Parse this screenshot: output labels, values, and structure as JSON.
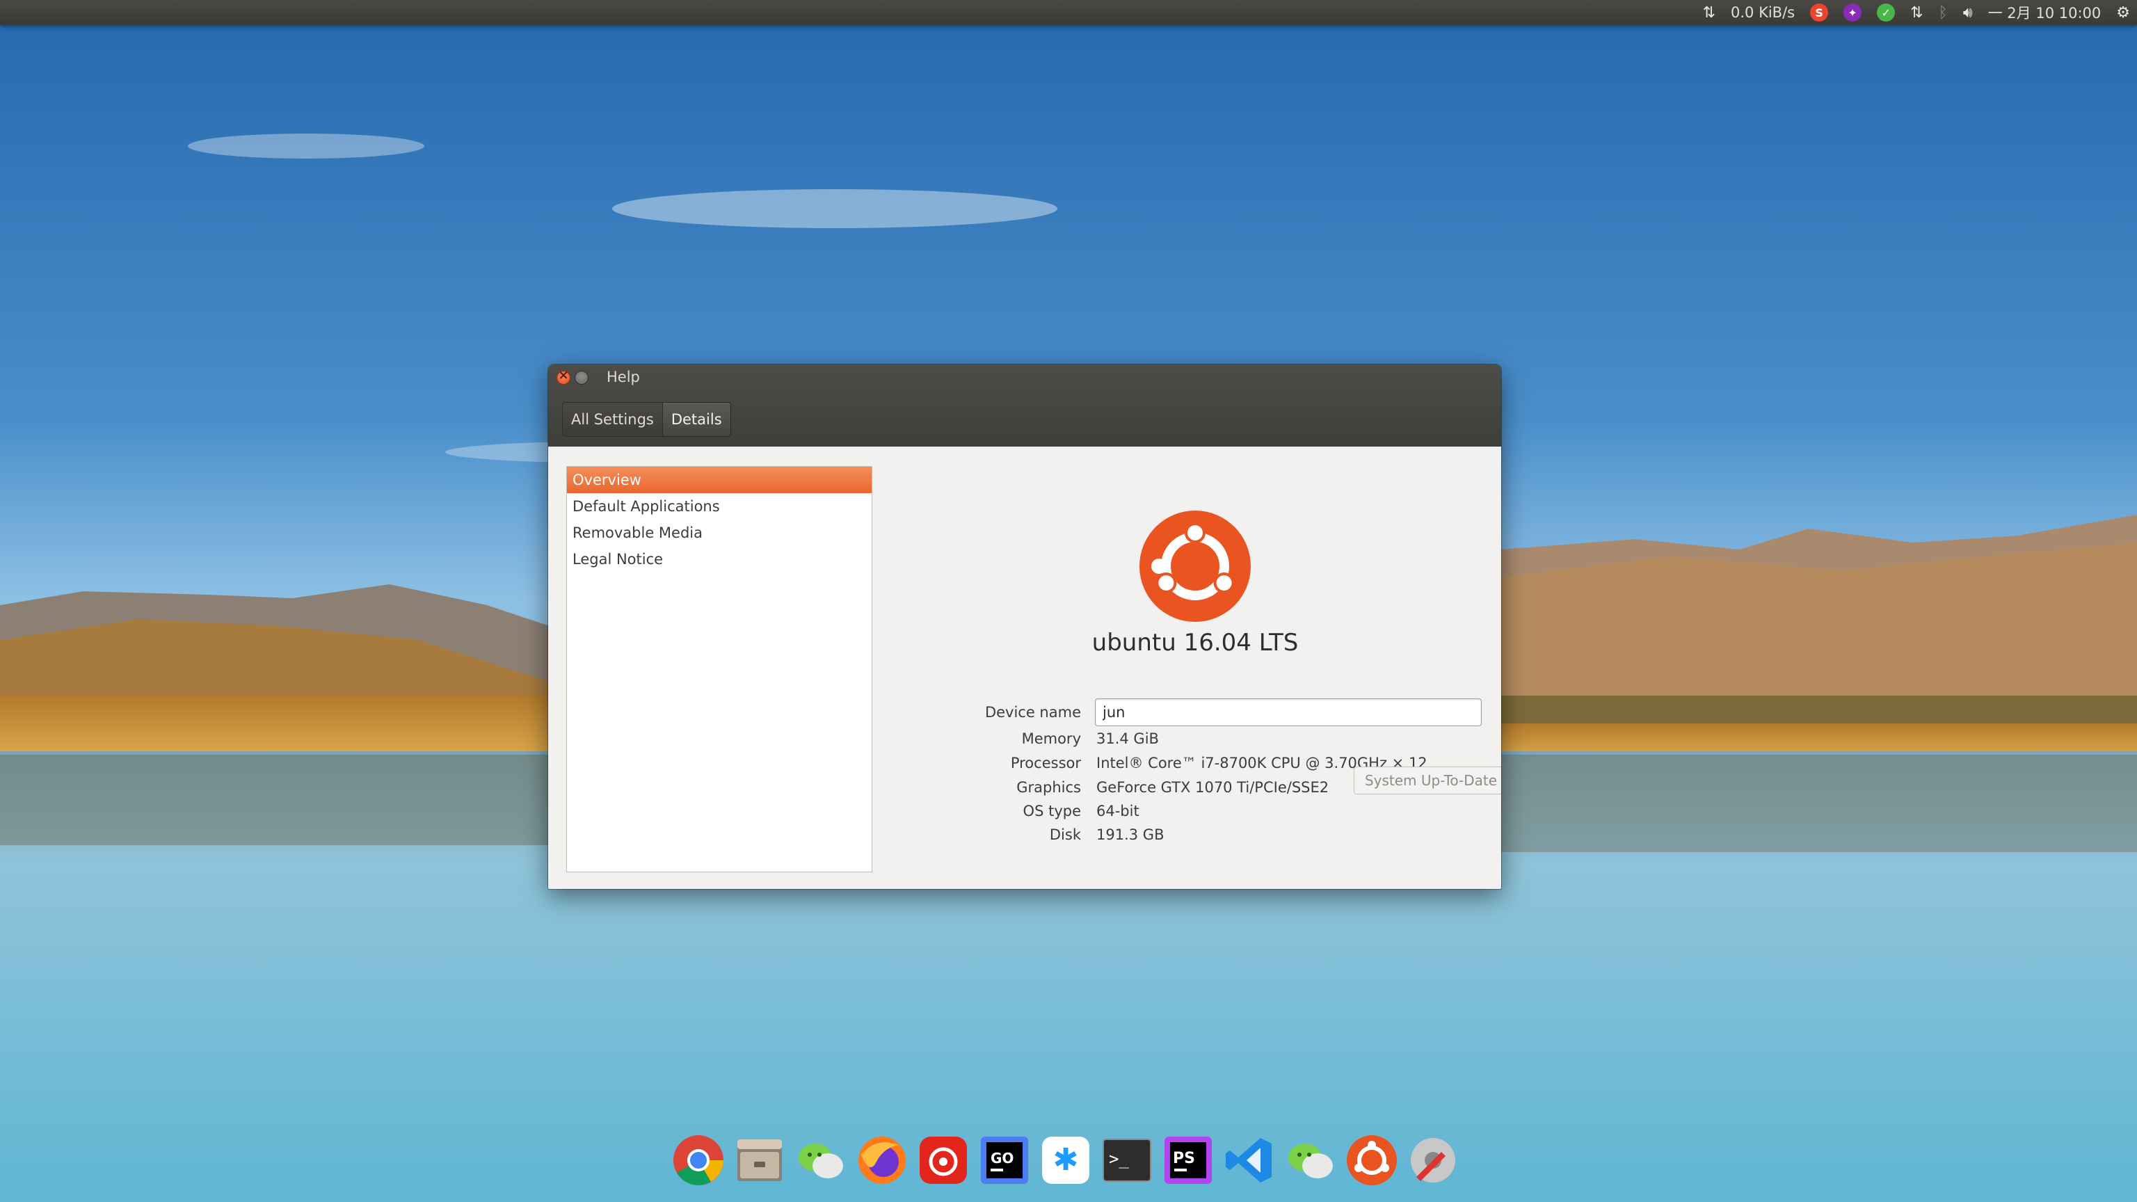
{
  "top_panel": {
    "network_speed": "0.0 KiB/s",
    "datetime": "一 2月 10 10:00",
    "tray_icons": [
      "network-transfer-icon",
      "network-speed-label",
      "sogou-input-icon",
      "weather-flame-icon",
      "green-check-icon",
      "updown-arrows-icon",
      "bluetooth-icon",
      "volume-icon",
      "datetime-label",
      "settings-gear-icon"
    ]
  },
  "window": {
    "title": "Help",
    "nav": {
      "all_settings": "All Settings",
      "details": "Details"
    },
    "sidebar": {
      "items": [
        {
          "label": "Overview",
          "selected": true
        },
        {
          "label": "Default Applications",
          "selected": false
        },
        {
          "label": "Removable Media",
          "selected": false
        },
        {
          "label": "Legal Notice",
          "selected": false
        }
      ]
    },
    "overview": {
      "os_name": "ubuntu 16.04 LTS",
      "device_name_label": "Device name",
      "device_name_value": "jun",
      "memory_label": "Memory",
      "memory_value": "31.4 GiB",
      "processor_label": "Processor",
      "processor_value": "Intel® Core™ i7-8700K CPU @ 3.70GHz × 12",
      "graphics_label": "Graphics",
      "graphics_value": "GeForce GTX 1070 Ti/PCIe/SSE2",
      "os_type_label": "OS type",
      "os_type_value": "64-bit",
      "disk_label": "Disk",
      "disk_value": "191.3 GB",
      "update_button": "System Up-To-Date"
    }
  },
  "dock": {
    "icons": [
      "chrome-icon",
      "files-icon",
      "wechat-icon",
      "firefox-icon",
      "netease-music-icon",
      "goland-icon",
      "xmind-icon",
      "terminal-icon",
      "phpstorm-icon",
      "vscode-icon",
      "wechat-icon",
      "ubuntu-software-icon",
      "system-tools-icon"
    ]
  },
  "colors": {
    "accent": "#e95420",
    "selection": "#f07746",
    "panel": "#3c3b37"
  }
}
